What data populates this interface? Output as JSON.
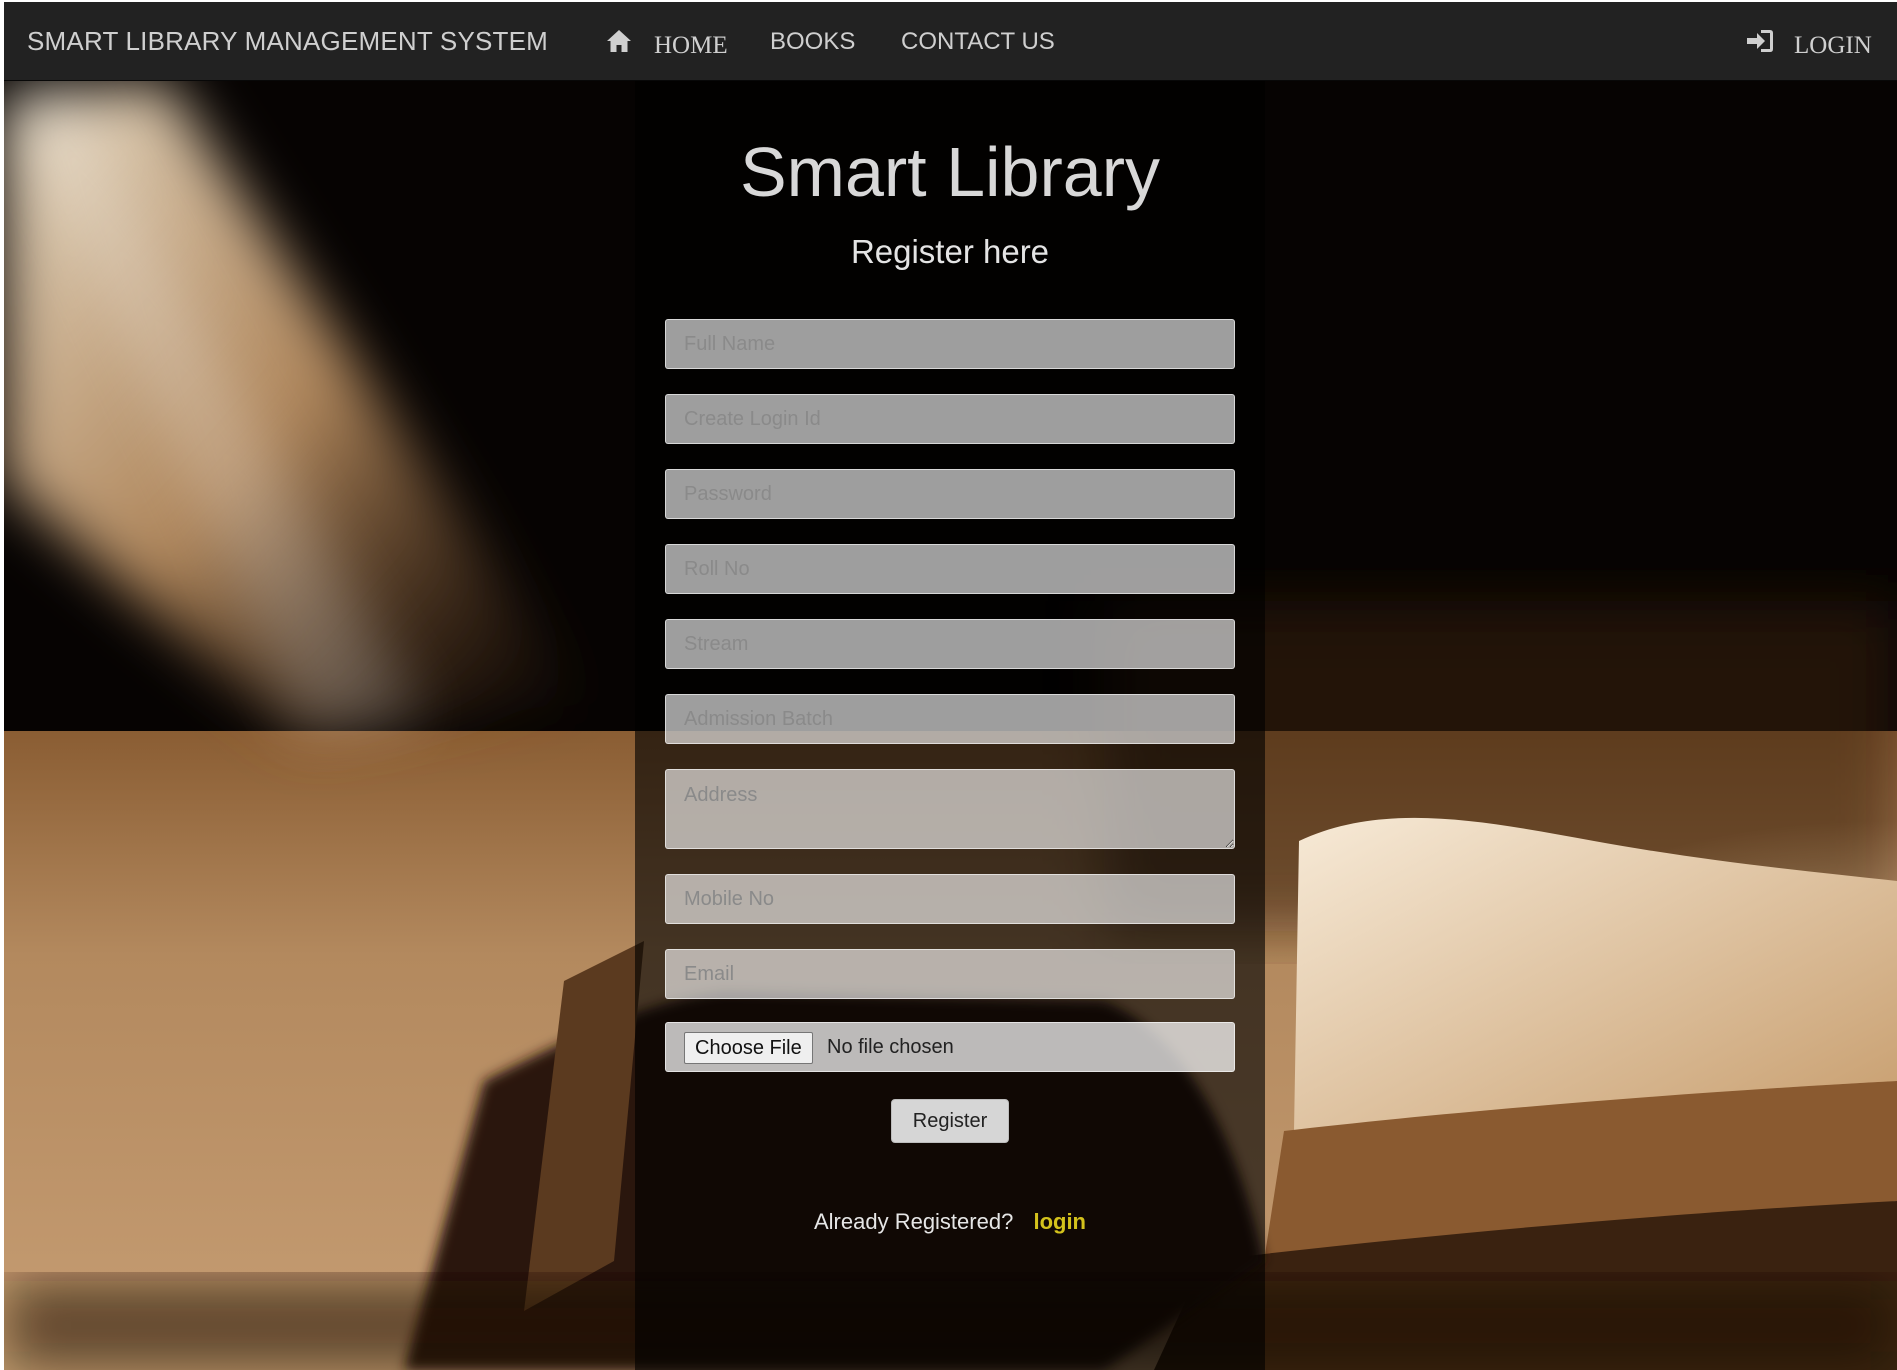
{
  "navbar": {
    "brand": "SMART LIBRARY MANAGEMENT SYSTEM",
    "items": [
      {
        "label": "HOME",
        "icon": "home-icon"
      },
      {
        "label": "BOOKS"
      },
      {
        "label": "CONTACT US"
      }
    ],
    "login": {
      "label": "LOGIN",
      "icon": "login-icon"
    }
  },
  "form": {
    "title": "Smart Library",
    "subtitle": "Register here",
    "fields": {
      "full_name": "Full Name",
      "login_id": "Create Login Id",
      "password": "Password",
      "roll_no": "Roll No",
      "stream": "Stream",
      "admission_batch": "Admission Batch",
      "address": "Address",
      "mobile": "Mobile No",
      "email": "Email"
    },
    "file": {
      "button_label": "Choose File",
      "status": "No file chosen"
    },
    "submit_label": "Register",
    "already_text": "Already Registered?",
    "login_link": "login"
  },
  "colors": {
    "navbar_bg": "#222222",
    "nav_text": "#cfcfcf",
    "link_accent": "#d4c21c"
  }
}
